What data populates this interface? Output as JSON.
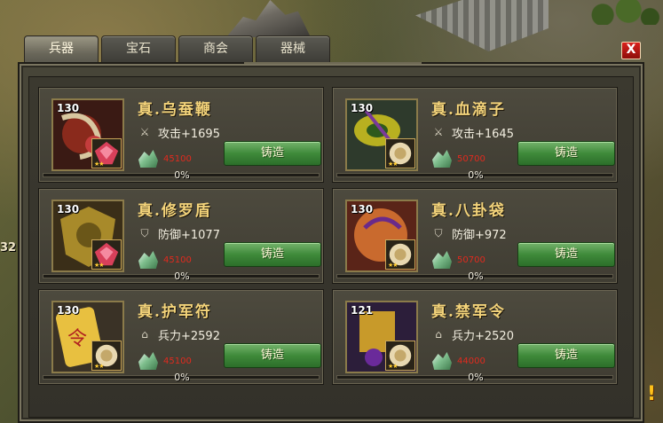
{
  "background": {
    "left_edge_text": "32"
  },
  "tabs": [
    {
      "label": "兵器",
      "active": true
    },
    {
      "label": "宝石",
      "active": false
    },
    {
      "label": "商会",
      "active": false
    },
    {
      "label": "器械",
      "active": false
    }
  ],
  "close_label": "X",
  "forge_label": "铸造",
  "colors": {
    "name_gold": "#f3d37a",
    "cost_red": "#e02a1e",
    "forge_green": "#3f8a3a",
    "close_red": "#d9221d"
  },
  "items": [
    {
      "level": "130",
      "name": "真.乌蚕鞭",
      "stat_icon": "sword-icon",
      "stat": "攻击+1695",
      "cost": "45100",
      "progress_label": "0%",
      "progress": 0,
      "icon": "whip-icon",
      "gem": "ruby-gem-icon",
      "stars": "★★"
    },
    {
      "level": "130",
      "name": "真.血滴子",
      "stat_icon": "sword-icon",
      "stat": "攻击+1645",
      "cost": "50700",
      "progress_label": "0%",
      "progress": 0,
      "icon": "xuedizi-icon",
      "gem": "jade-gem-icon",
      "stars": "★★"
    },
    {
      "level": "130",
      "name": "真.修罗盾",
      "stat_icon": "shield-icon",
      "stat": "防御+1077",
      "cost": "45100",
      "progress_label": "0%",
      "progress": 0,
      "icon": "shield-item-icon",
      "gem": "ruby-gem-icon",
      "stars": "★★"
    },
    {
      "level": "130",
      "name": "真.八卦袋",
      "stat_icon": "shield-icon",
      "stat": "防御+972",
      "cost": "50700",
      "progress_label": "0%",
      "progress": 0,
      "icon": "bagua-bag-icon",
      "gem": "jade-gem-icon",
      "stars": "★★"
    },
    {
      "level": "130",
      "name": "真.护军符",
      "stat_icon": "helmet-icon",
      "stat": "兵力+2592",
      "cost": "45100",
      "progress_label": "0%",
      "progress": 0,
      "icon": "talisman-icon",
      "gem": "jade-gem-icon",
      "stars": "★★"
    },
    {
      "level": "121",
      "name": "真.禁军令",
      "stat_icon": "helmet-icon",
      "stat": "兵力+2520",
      "cost": "44000",
      "progress_label": "0%",
      "progress": 0,
      "icon": "command-token-icon",
      "gem": "jade-gem-icon",
      "stars": "★★"
    }
  ]
}
